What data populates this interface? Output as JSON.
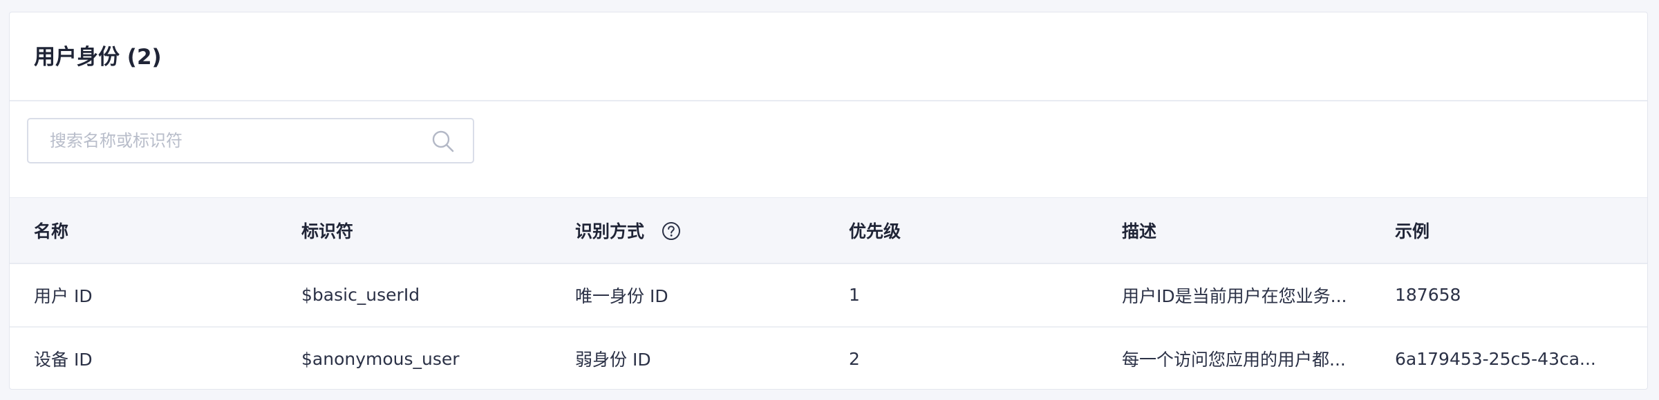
{
  "card": {
    "title": "用户身份 (2)"
  },
  "search": {
    "placeholder": "搜索名称或标识符",
    "value": "",
    "icon": "search-icon"
  },
  "table": {
    "headers": {
      "name": "名称",
      "identifier": "标识符",
      "method": "识别方式",
      "priority": "优先级",
      "description": "描述",
      "example": "示例"
    },
    "method_help_icon": "question-circle-icon",
    "rows": [
      {
        "name": "用户 ID",
        "identifier": "$basic_userId",
        "method": "唯一身份 ID",
        "priority": "1",
        "description": "用户ID是当前用户在您业务...",
        "example": "187658"
      },
      {
        "name": "设备 ID",
        "identifier": "$anonymous_user",
        "method": "弱身份 ID",
        "priority": "2",
        "description": "每一个访问您应用的用户都...",
        "example": "6a179453-25c5-43ca..."
      }
    ]
  },
  "colors": {
    "background": "#f5f6fa",
    "card": "#ffffff",
    "text": "#2b3146",
    "border": "#e8ebf2",
    "placeholder": "#b8bdca"
  }
}
